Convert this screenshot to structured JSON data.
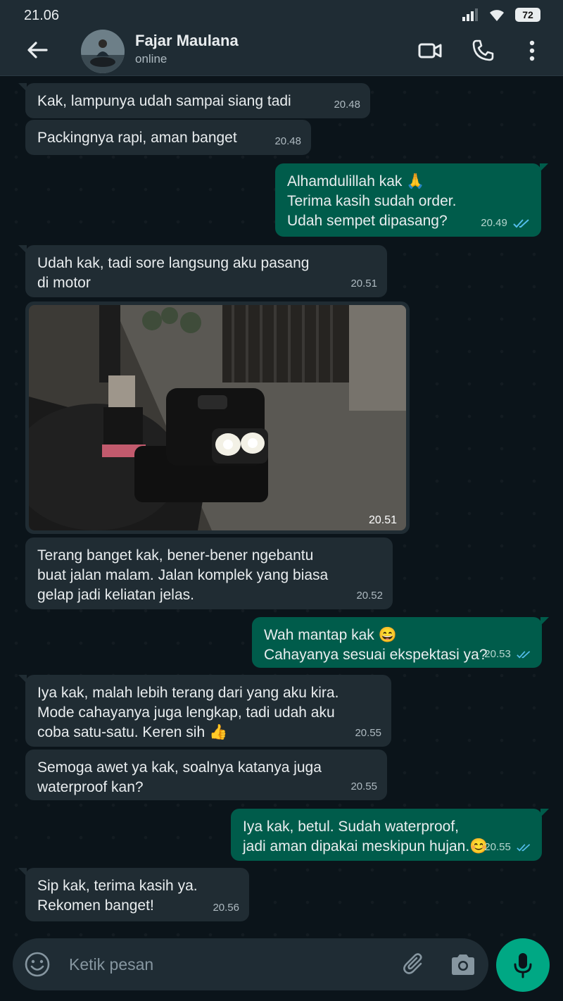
{
  "status_bar": {
    "time": "21.06",
    "battery": "72"
  },
  "header": {
    "contact_name": "Fajar Maulana",
    "contact_status": "online"
  },
  "messages": [
    {
      "text": "Kak, lampunya udah sampai siang tadi",
      "time": "20.48"
    },
    {
      "text": "Packingnya rapi, aman banget",
      "time": "20.48"
    },
    {
      "text": "Alhamdulillah kak 🙏\nTerima kasih sudah order.\nUdah sempet dipasang?",
      "time": "20.49"
    },
    {
      "text": "Udah kak, tadi sore langsung aku pasang\ndi motor",
      "time": "20.51"
    },
    {
      "text": "",
      "time": "20.51"
    },
    {
      "text": "Terang banget kak, bener-bener ngebantu\nbuat jalan malam. Jalan komplek yang biasa\ngelap jadi keliatan jelas.",
      "time": "20.52"
    },
    {
      "text": "Wah mantap kak 😄\nCahayanya sesuai ekspektasi ya?",
      "time": "20.53"
    },
    {
      "text": "Iya kak, malah lebih terang dari yang aku kira.\nMode cahayanya juga lengkap, tadi udah aku\ncoba satu-satu. Keren sih 👍",
      "time": "20.55"
    },
    {
      "text": "Semoga awet ya kak, soalnya katanya juga\nwaterproof kan?",
      "time": "20.55"
    },
    {
      "text": "Iya kak, betul. Sudah waterproof,\njadi aman dipakai meskipun hujan.😊",
      "time": "20.55"
    },
    {
      "text": "Sip kak, terima kasih ya.\nRekomen banget!",
      "time": "20.56"
    }
  ],
  "input": {
    "placeholder": "Ketik pesan"
  },
  "icons": {
    "back": "arrow-left-icon",
    "video": "video-call-icon",
    "call": "phone-icon",
    "menu": "more-vertical-icon",
    "emoji": "emoji-icon",
    "attach": "paperclip-icon",
    "camera": "camera-icon",
    "mic": "microphone-icon",
    "read": "double-check-icon"
  },
  "colors": {
    "background": "#0b141a",
    "header": "#1f2c34",
    "incoming_bubble": "#202c33",
    "outgoing_bubble": "#005c4b",
    "accent": "#00a884",
    "read_ticks": "#53bdeb"
  }
}
